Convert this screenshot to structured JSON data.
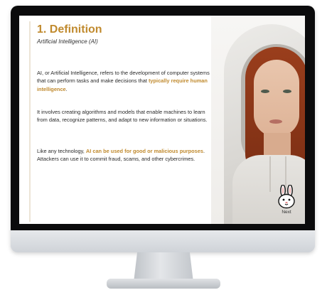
{
  "slide": {
    "title": "1. Definition",
    "subtitle": "Artificial Intelligence (AI)",
    "paragraph1": {
      "text_before": "AI, or Artificial Intelligence, refers to the development of computer systems that can perform tasks and make decisions that ",
      "highlight": "typically require human intelligence",
      "text_after": "."
    },
    "paragraph2": {
      "text": "It involves creating algorithms and models that enable machines to learn from data, recognize patterns, and adapt to new information or situations."
    },
    "paragraph3": {
      "text_before": "Like any technology, ",
      "highlight": "AI can be used for good or malicious purposes",
      "text_after": ". Attackers can use it to commit fraud, scams, and other cybercrimes."
    },
    "accent_color": "#c08a2e"
  },
  "navigation": {
    "next_label": "Next",
    "next_icon": "bunny-icon"
  }
}
